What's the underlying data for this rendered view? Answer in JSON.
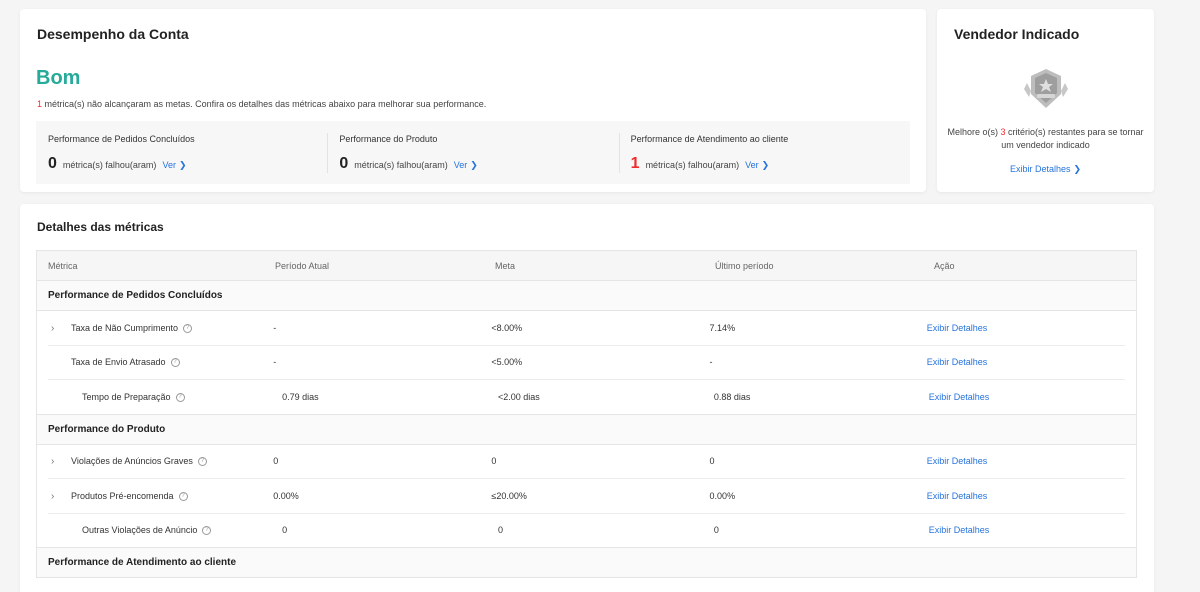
{
  "account": {
    "title": "Desempenho da Conta",
    "status": "Bom",
    "desc_count": "1",
    "desc_text": " métrica(s) não alcançaram as metas. Confira os detalhes das métricas abaixo para melhorar sua performance.",
    "summary": [
      {
        "title": "Performance de Pedidos Concluídos",
        "count": "0",
        "fail": "métrica(s) falhou(aram)",
        "link": "Ver"
      },
      {
        "title": "Performance do Produto",
        "count": "0",
        "fail": "métrica(s) falhou(aram)",
        "link": "Ver"
      },
      {
        "title": "Performance de Atendimento ao cliente",
        "count": "1",
        "fail": "métrica(s) falhou(aram)",
        "link": "Ver"
      }
    ]
  },
  "seller": {
    "title": "Vendedor Indicado",
    "msg_pre": "Melhore o(s) ",
    "msg_count": "3",
    "msg_post": " critério(s) restantes para se tornar um vendedor indicado",
    "details": "Exibir Detalhes"
  },
  "metrics": {
    "title": "Detalhes das métricas",
    "headers": [
      "Métrica",
      "Período Atual",
      "Meta",
      "Último período",
      "Ação"
    ],
    "groups": [
      {
        "name": "Performance de Pedidos Concluídos",
        "rows": [
          {
            "metric": "Taxa de Não Cumprimento",
            "current": "-",
            "target": "<8.00%",
            "last": "7.14%",
            "action": "Exibir Detalhes"
          },
          {
            "metric": "Taxa de Envio Atrasado",
            "current": "-",
            "target": "<5.00%",
            "last": "-",
            "action": "Exibir Detalhes"
          },
          {
            "metric": "Tempo de Preparação",
            "current": "0.79 dias",
            "target": "<2.00 dias",
            "last": "0.88 dias",
            "action": "Exibir Detalhes"
          }
        ]
      },
      {
        "name": "Performance do Produto",
        "rows": [
          {
            "metric": "Violações de Anúncios Graves",
            "current": "0",
            "target": "0",
            "last": "0",
            "action": "Exibir Detalhes"
          },
          {
            "metric": "Produtos Pré-encomenda",
            "current": "0.00%",
            "target": "≤20.00%",
            "last": "0.00%",
            "action": "Exibir Detalhes"
          },
          {
            "metric": "Outras Violações de Anúncio",
            "current": "0",
            "target": "0",
            "last": "0",
            "action": "Exibir Detalhes"
          }
        ]
      },
      {
        "name": "Performance de Atendimento ao cliente"
      }
    ]
  }
}
